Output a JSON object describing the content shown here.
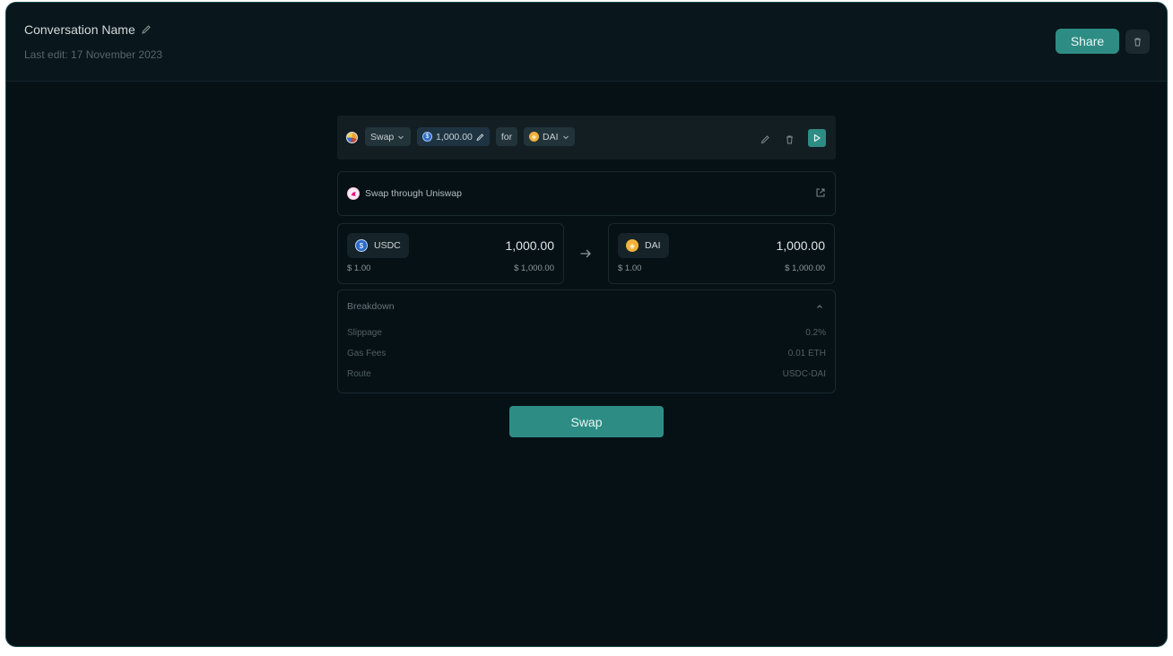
{
  "header": {
    "conversation_name": "Conversation Name",
    "last_edit": "Last edit: 17 November 2023",
    "share_label": "Share"
  },
  "command": {
    "action": "Swap",
    "amount": "1,000.00",
    "connector": "for",
    "to_token": "DAI"
  },
  "protocol": {
    "label": "Swap through Uniswap"
  },
  "from": {
    "token": "USDC",
    "amount": "1,000.00",
    "price": "$ 1.00",
    "value": "$ 1,000.00"
  },
  "to": {
    "token": "DAI",
    "amount": "1,000.00",
    "price": "$ 1.00",
    "value": "$ 1,000.00"
  },
  "breakdown": {
    "title": "Breakdown",
    "rows": [
      {
        "label": "Slippage",
        "value": "0.2%"
      },
      {
        "label": "Gas Fees",
        "value": "0.01 ETH"
      },
      {
        "label": "Route",
        "value": "USDC-DAI"
      }
    ]
  },
  "swap_button_label": "Swap",
  "colors": {
    "accent": "#2d8d84",
    "background": "#061116",
    "header": "#09161b",
    "usdc": "#2b6ac9",
    "dai": "#efb23a"
  }
}
